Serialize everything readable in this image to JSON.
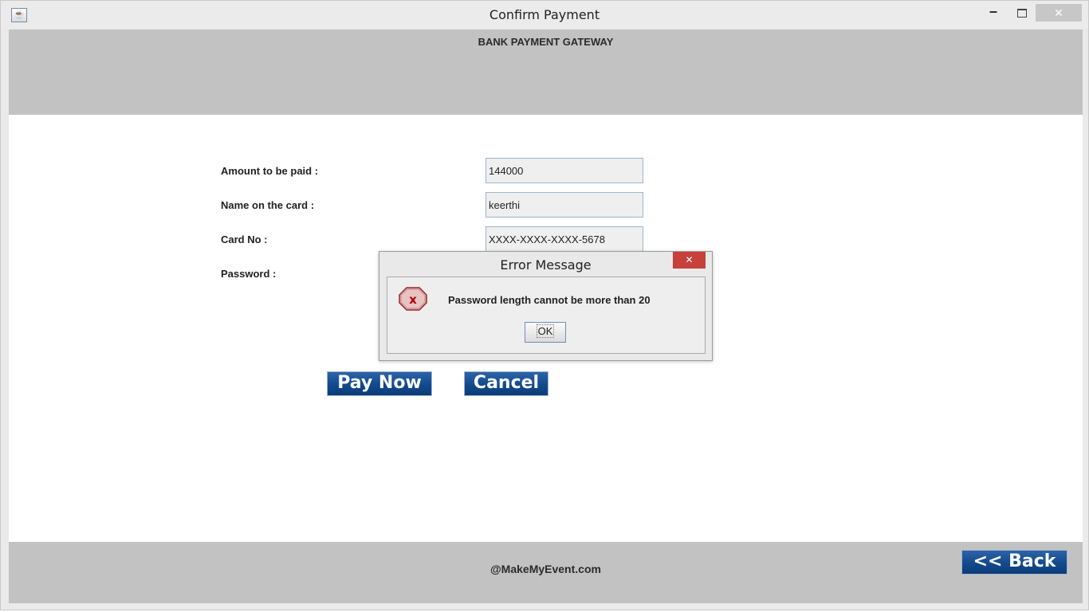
{
  "window": {
    "title": "Confirm Payment",
    "controls": {
      "minimize": "–",
      "close": "✕"
    }
  },
  "header": {
    "title": "BANK PAYMENT GATEWAY"
  },
  "form": {
    "amount_label": "Amount to be paid :",
    "amount_value": "144000",
    "name_label": "Name on the card :",
    "name_value": "keerthi",
    "card_label": "Card No :",
    "card_value": "XXXX-XXXX-XXXX-5678",
    "password_label": "Password :"
  },
  "buttons": {
    "pay_now": "Pay Now",
    "cancel": "Cancel",
    "back": "<< Back"
  },
  "footer": {
    "text": "@MakeMyEvent.com"
  },
  "dialog": {
    "title": "Error Message",
    "message": "Password length cannot be more than 20",
    "ok_label": "OK",
    "close": "✕",
    "icon": "error-icon"
  },
  "colors": {
    "band_gray": "#c2c2c2",
    "button_blue": "#134a8c",
    "error_red": "#c8403a"
  }
}
